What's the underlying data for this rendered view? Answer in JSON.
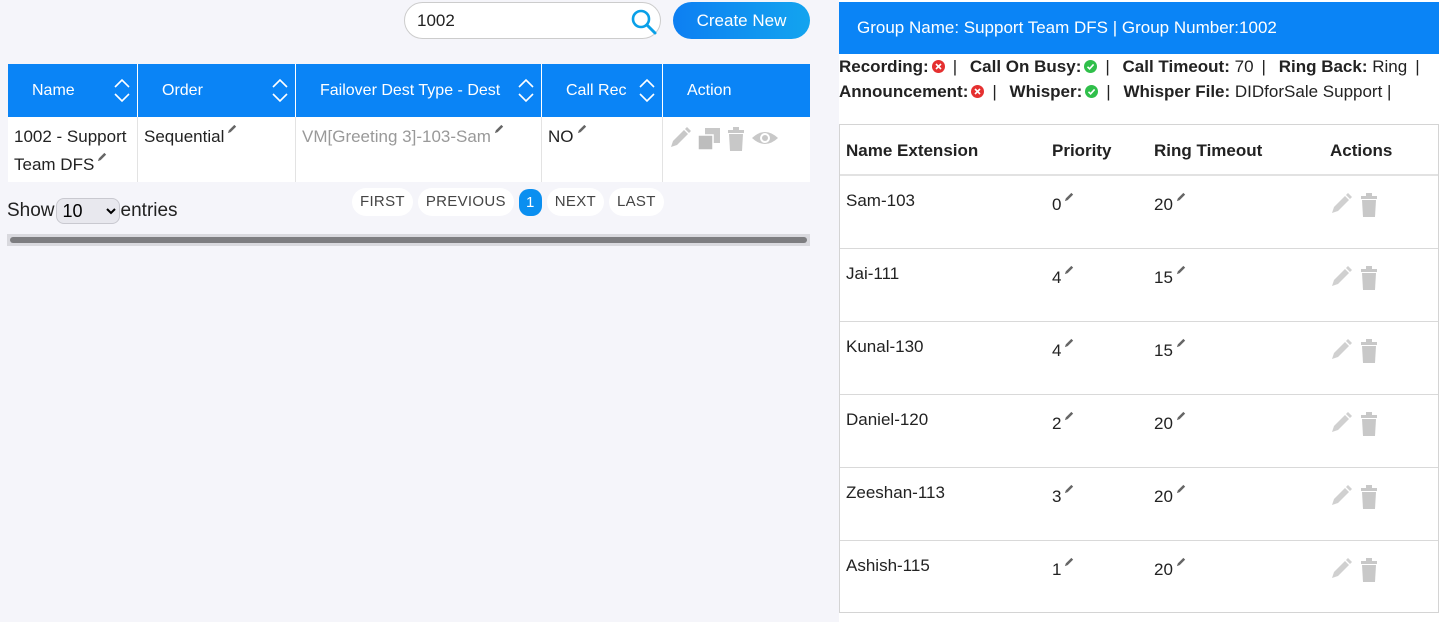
{
  "search": {
    "value": "1002"
  },
  "toolbar": {
    "create_label": "Create New"
  },
  "grid": {
    "headers": [
      "Name",
      "Order",
      "Failover Dest Type - Dest",
      "Call Rec",
      "Action"
    ],
    "row": {
      "name": "1002 - Support Team DFS",
      "order": "Sequential",
      "failover": "VM[Greeting 3]-103-Sam",
      "call_rec": "NO"
    }
  },
  "paging": {
    "show_label": "Show",
    "entries_label": "entries",
    "page_size": "10",
    "first": "FIRST",
    "previous": "PREVIOUS",
    "current": "1",
    "next": "NEXT",
    "last": "LAST"
  },
  "group": {
    "title": "Group Name: Support Team DFS | Group Number:1002",
    "recording_label": "Recording:",
    "call_on_busy_label": "Call On Busy:",
    "call_timeout_label": "Call Timeout:",
    "call_timeout_value": "70",
    "ring_back_label": "Ring Back:",
    "ring_back_value": "Ring",
    "announcement_label": "Announcement:",
    "whisper_label": "Whisper:",
    "whisper_file_label": "Whisper File:",
    "whisper_file_value": "DIDforSale Support |",
    "recording_enabled": false,
    "call_on_busy_enabled": true,
    "announcement_enabled": false,
    "whisper_enabled": true
  },
  "members": {
    "headers": [
      "Name Extension",
      "Priority",
      "Ring Timeout",
      "Actions"
    ],
    "rows": [
      {
        "name": "Sam-103",
        "priority": "0",
        "timeout": "20"
      },
      {
        "name": "Jai-111",
        "priority": "4",
        "timeout": "15"
      },
      {
        "name": "Kunal-130",
        "priority": "4",
        "timeout": "15"
      },
      {
        "name": "Daniel-120",
        "priority": "2",
        "timeout": "20"
      },
      {
        "name": "Zeeshan-113",
        "priority": "3",
        "timeout": "20"
      },
      {
        "name": "Ashish-115",
        "priority": "1",
        "timeout": "20"
      }
    ]
  },
  "colors": {
    "accent": "#0a84f6",
    "danger": "#e53030",
    "success": "#2fbf4a"
  }
}
